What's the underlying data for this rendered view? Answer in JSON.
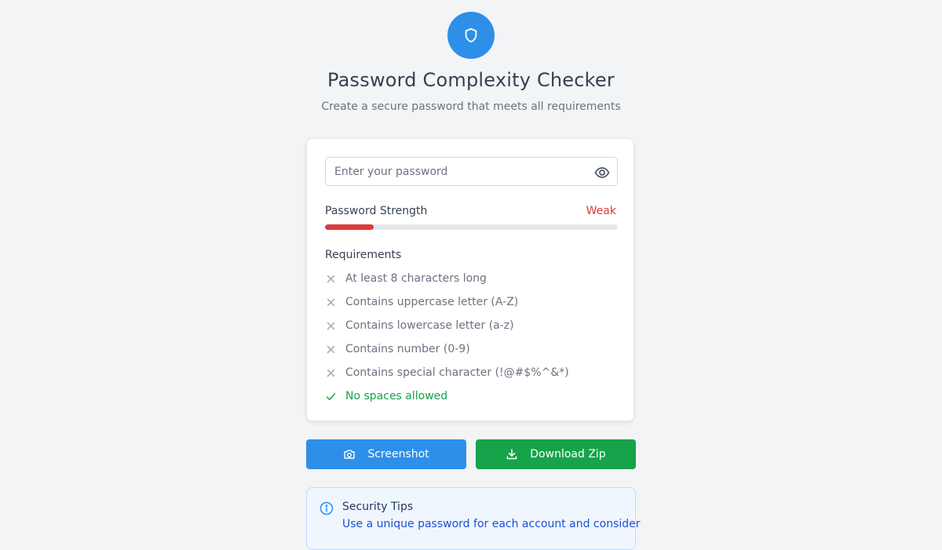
{
  "header": {
    "title": "Password Complexity Checker",
    "subtitle": "Create a secure password that meets all requirements",
    "logo_icon": "shield-icon",
    "logo_color": "#2e8fe8"
  },
  "password": {
    "value": "",
    "placeholder": "Enter your password",
    "toggle_icon": "eye-icon"
  },
  "strength": {
    "label": "Password Strength",
    "value": "Weak",
    "level_fraction": 0.166,
    "color": "#dc3b3b"
  },
  "requirements": {
    "heading": "Requirements",
    "items": [
      {
        "label": "At least 8 characters long",
        "met": false
      },
      {
        "label": "Contains uppercase letter (A-Z)",
        "met": false
      },
      {
        "label": "Contains lowercase letter (a-z)",
        "met": false
      },
      {
        "label": "Contains number (0-9)",
        "met": false
      },
      {
        "label": "Contains special character (!@#$%^&*)",
        "met": false
      },
      {
        "label": "No spaces allowed",
        "met": true
      }
    ],
    "met_color": "#16a34a",
    "unmet_color": "#9ca3af"
  },
  "actions": {
    "screenshot_label": "Screenshot",
    "screenshot_icon": "camera-icon",
    "download_label": "Download Zip",
    "download_icon": "download-icon"
  },
  "tips": {
    "title": "Security Tips",
    "text": "Use a unique password for each account and consider",
    "icon": "info-icon"
  }
}
